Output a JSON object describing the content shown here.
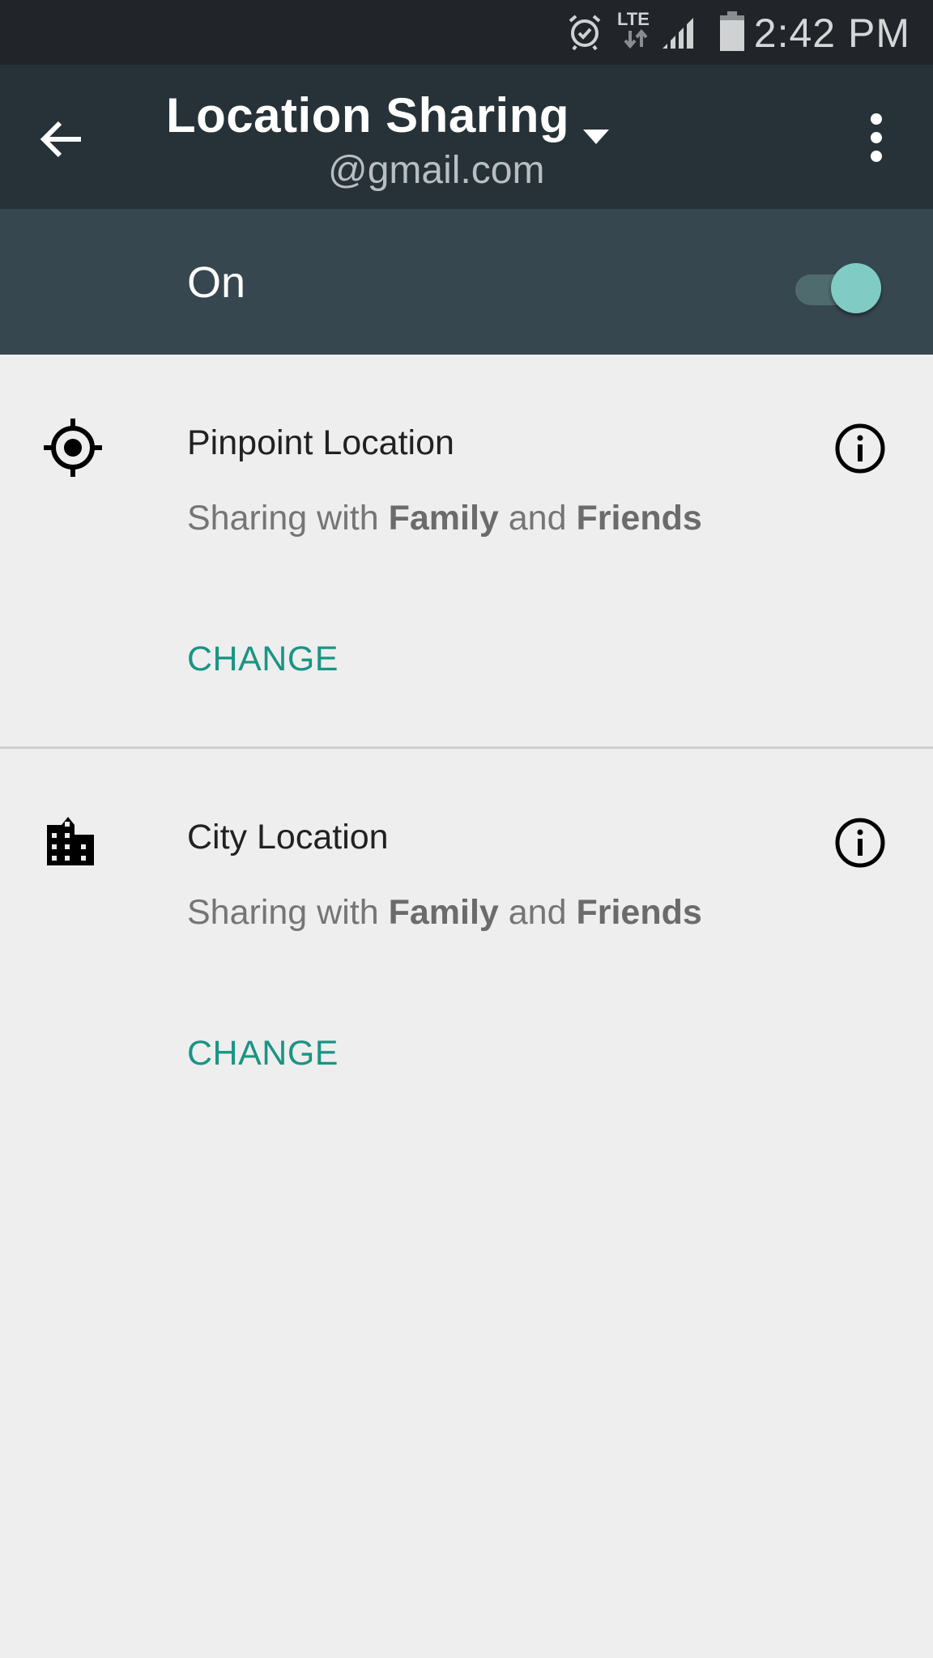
{
  "status_bar": {
    "icons": [
      "alarm-icon",
      "lte-icon",
      "signal-icon",
      "battery-icon"
    ],
    "lte_label": "LTE",
    "time": "2:42 PM"
  },
  "app_bar": {
    "back_icon": "arrow-back-icon",
    "title": "Location Sharing",
    "dropdown_icon": "arrow-drop-down-icon",
    "account": "@gmail.com",
    "menu_icon": "more-vert-icon"
  },
  "master_toggle": {
    "label": "On",
    "state": true,
    "accent": "#80cbc4"
  },
  "items": [
    {
      "icon": "gps-fixed-icon",
      "title": "Pinpoint Location",
      "subtitle_prefix": "Sharing with ",
      "group1": "Family",
      "conjunction": " and ",
      "group2": "Friends",
      "action": "CHANGE",
      "info_icon": "info-icon"
    },
    {
      "icon": "city-icon",
      "title": "City Location",
      "subtitle_prefix": "Sharing with ",
      "group1": "Family",
      "conjunction": " and ",
      "group2": "Friends",
      "action": "CHANGE",
      "info_icon": "info-icon"
    }
  ],
  "colors": {
    "status_bar": "#212529",
    "app_bar": "#263238",
    "toggle_row": "#37474f",
    "background": "#eeeeee",
    "action_text": "#1a9484"
  }
}
